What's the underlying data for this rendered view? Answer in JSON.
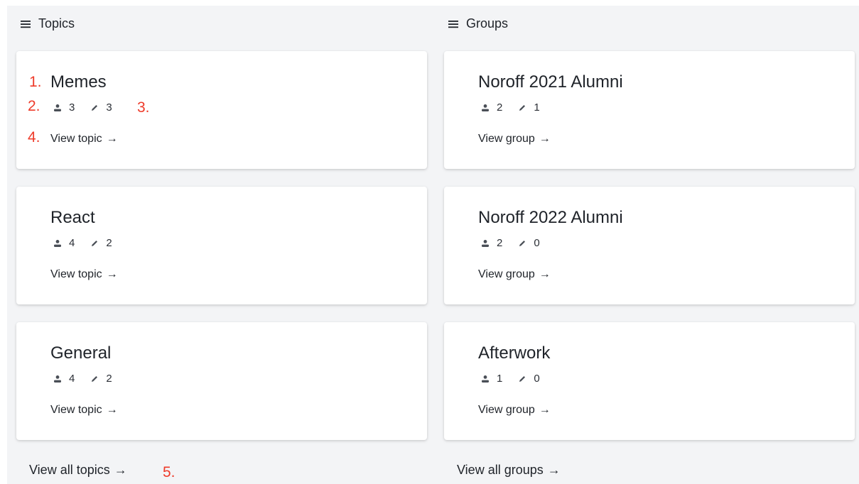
{
  "topics": {
    "heading": "Topics",
    "items": [
      {
        "title": "Memes",
        "members": "3",
        "posts": "3",
        "link_label": "View topic"
      },
      {
        "title": "React",
        "members": "4",
        "posts": "2",
        "link_label": "View topic"
      },
      {
        "title": "General",
        "members": "4",
        "posts": "2",
        "link_label": "View topic"
      }
    ],
    "view_all_label": "View all topics"
  },
  "groups": {
    "heading": "Groups",
    "items": [
      {
        "title": "Noroff 2021 Alumni",
        "members": "2",
        "posts": "1",
        "link_label": "View group"
      },
      {
        "title": "Noroff 2022 Alumni",
        "members": "2",
        "posts": "0",
        "link_label": "View group"
      },
      {
        "title": "Afterwork",
        "members": "1",
        "posts": "0",
        "link_label": "View group"
      }
    ],
    "view_all_label": "View all groups"
  },
  "arrow": "→",
  "annotations": [
    "1.",
    "2.",
    "3.",
    "4.",
    "5."
  ],
  "colors": {
    "annotation": "#ee3b2a",
    "background": "#f3f4f6",
    "card": "#ffffff"
  },
  "icons": {
    "header": "menu-lines-icon",
    "members": "person-icon",
    "posts": "pencil-icon"
  }
}
